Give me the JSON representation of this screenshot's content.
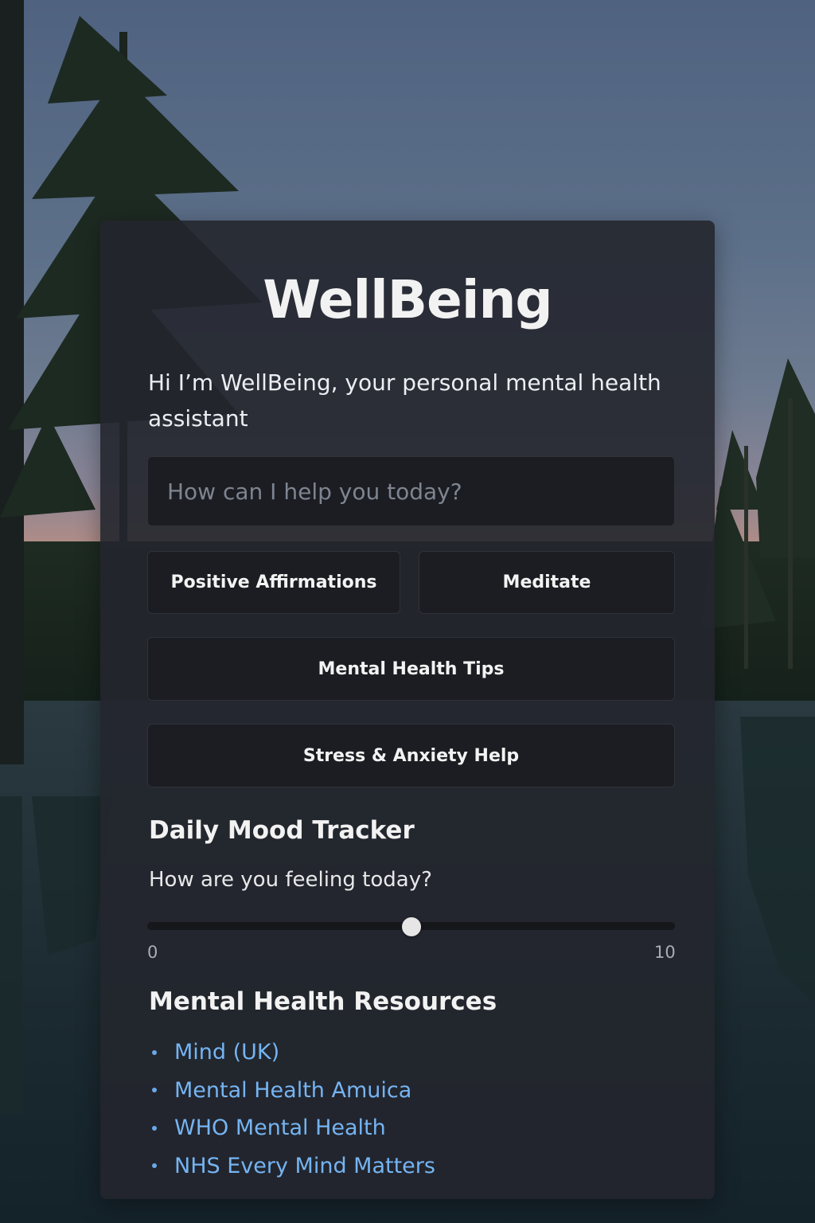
{
  "app": {
    "title": "WellBeing",
    "intro": "Hi I’m WellBeing, your personal mental health assistant"
  },
  "search": {
    "placeholder": "How can I help you today?"
  },
  "actions": {
    "affirmations": "Positive Affirmations",
    "meditate": "Meditate",
    "tips": "Mental Health Tips",
    "stress": "Stress & Anxiety Help"
  },
  "mood": {
    "title": "Daily Mood Tracker",
    "question": "How are you feeling today?",
    "min_label": "0",
    "max_label": "10",
    "min": 0,
    "max": 10,
    "value": 5
  },
  "resources": {
    "title": "Mental Health Resources",
    "links": [
      "Mind (UK)",
      "Mental Health Amuica",
      "WHO Mental Health",
      "NHS Every Mind Matters"
    ]
  },
  "colors": {
    "link": "#75b4f2",
    "card": "#23262d",
    "button": "#1b1d22"
  },
  "background": "forest-lake-at-dusk"
}
